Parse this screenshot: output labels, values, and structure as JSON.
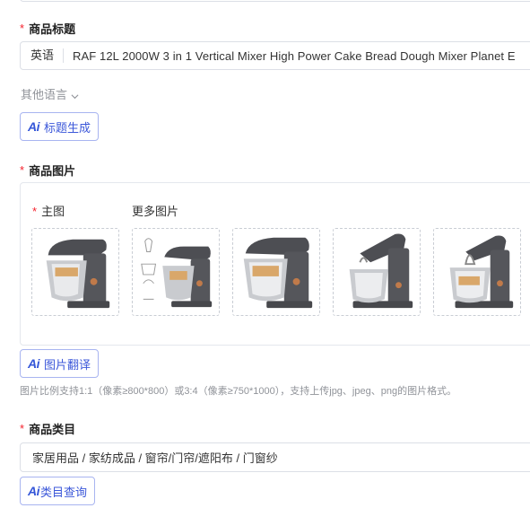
{
  "title_section": {
    "label": "商品标题",
    "lang_prefix": "英语",
    "value": "RAF 12L 2000W 3 in 1 Vertical Mixer High Power Cake Bread Dough Mixer Planet E",
    "other_languages": "其他语言",
    "ai_button": "标题生成"
  },
  "images_section": {
    "label": "商品图片",
    "main_label": "主图",
    "more_label": "更多图片",
    "ai_button": "图片翻译",
    "hint": "图片比例支持1:1（像素≥800*800）或3:4（像素≥750*1000），支持上传jpg、jpeg、png的图片格式。",
    "thumbnails": [
      {
        "icon": "stand-mixer-front-image",
        "tone": "#5a5b60"
      },
      {
        "icon": "stand-mixer-diagram-image",
        "tone": "#5a5b60"
      },
      {
        "icon": "stand-mixer-side-image",
        "tone": "#5a5b60"
      },
      {
        "icon": "stand-mixer-head-up-image",
        "tone": "#5a5b60"
      },
      {
        "icon": "stand-mixer-bowl-image",
        "tone": "#5a5b60"
      }
    ]
  },
  "category_section": {
    "label": "商品类目",
    "value": "家居用品 / 家纺成品 / 窗帘/门帘/遮阳布 / 门窗纱",
    "ai_button": "类目查询"
  },
  "colors": {
    "required": "#f5222d",
    "accent": "#3b57d9",
    "border": "#dcdfe6"
  }
}
